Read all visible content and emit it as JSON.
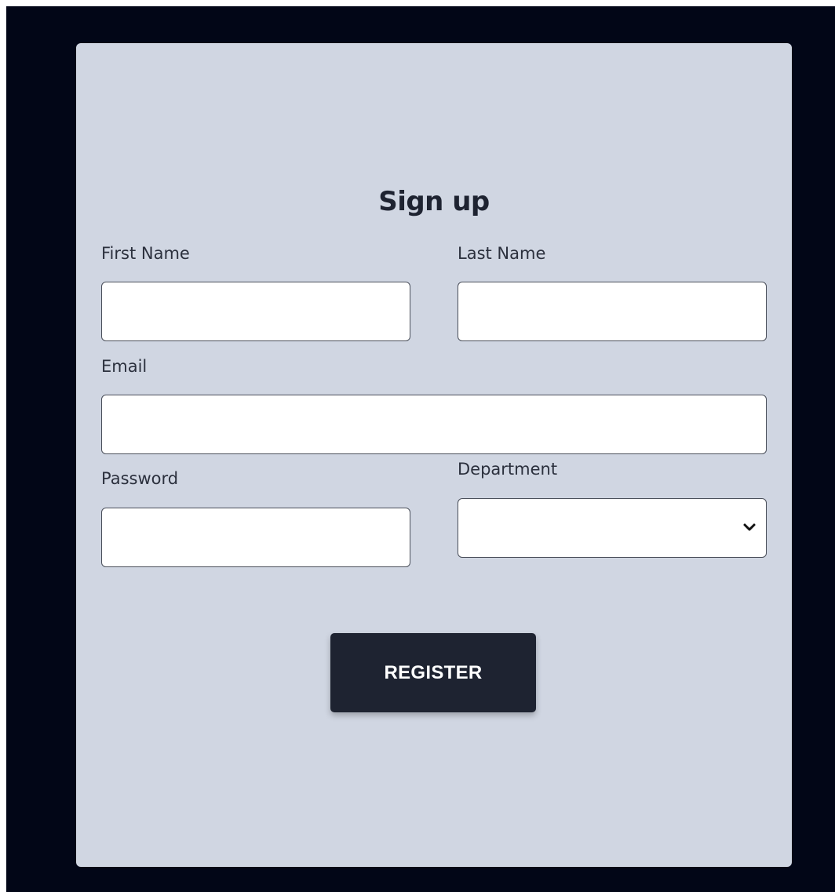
{
  "form": {
    "title": "Sign up",
    "first_name": {
      "label": "First Name",
      "value": "",
      "placeholder": ""
    },
    "last_name": {
      "label": "Last Name",
      "value": "",
      "placeholder": ""
    },
    "email": {
      "label": "Email",
      "value": "",
      "placeholder": ""
    },
    "password": {
      "label": "Password",
      "value": "",
      "placeholder": ""
    },
    "department": {
      "label": "Department",
      "selected": ""
    },
    "submit_label": "REGISTER"
  },
  "colors": {
    "page_background": "#020617",
    "card_background": "#d0d6e2",
    "button_background": "#1e2331",
    "button_text": "#ffffff"
  },
  "icons": {
    "department_select": "chevron-down-icon"
  }
}
